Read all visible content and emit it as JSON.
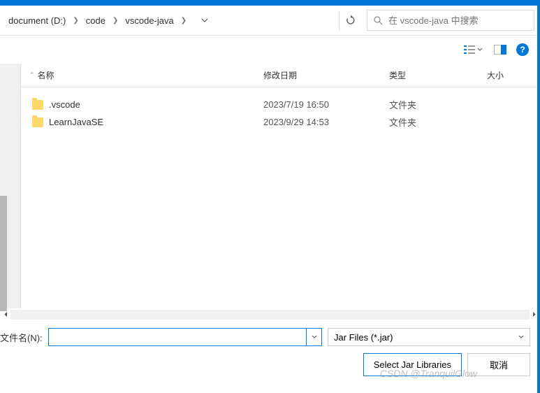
{
  "breadcrumb": {
    "items": [
      "document (D:)",
      "code",
      "vscode-java"
    ]
  },
  "search": {
    "placeholder": "在 vscode-java 中搜索"
  },
  "columns": {
    "name": "名称",
    "date": "修改日期",
    "type": "类型",
    "size": "大小"
  },
  "files": [
    {
      "name": ".vscode",
      "date": "2023/7/19 16:50",
      "type": "文件夹"
    },
    {
      "name": "LearnJavaSE",
      "date": "2023/9/29 14:53",
      "type": "文件夹"
    }
  ],
  "footer": {
    "file_label": "文件名(N):",
    "filter": "Jar Files (*.jar)",
    "select_btn": "Select Jar Libraries",
    "cancel_btn": "取消"
  },
  "watermark": "CSDN @TranquilGlow"
}
